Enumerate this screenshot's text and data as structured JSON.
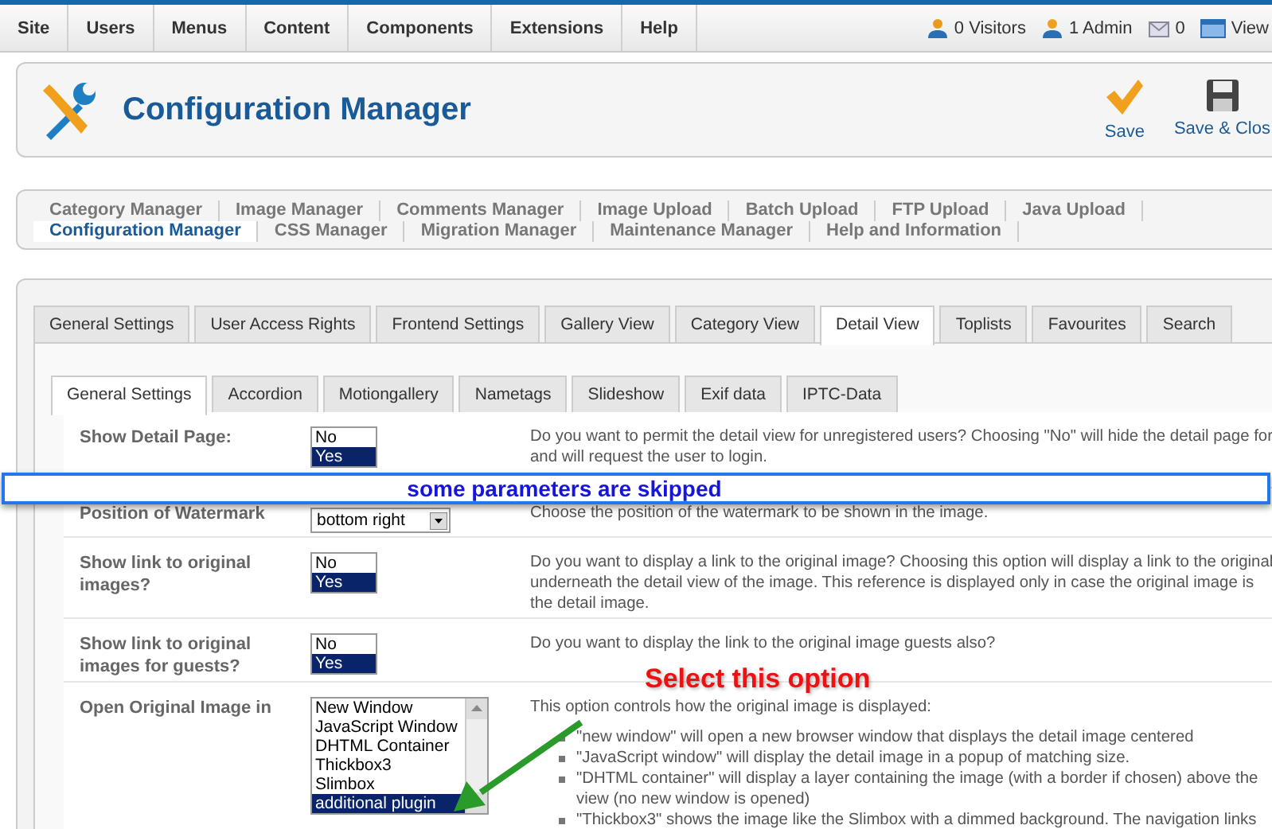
{
  "menu": [
    {
      "label": "Site"
    },
    {
      "label": "Users"
    },
    {
      "label": "Menus"
    },
    {
      "label": "Content"
    },
    {
      "label": "Components"
    },
    {
      "label": "Extensions"
    },
    {
      "label": "Help"
    }
  ],
  "status": [
    {
      "kind": "users",
      "label": "0 Visitors"
    },
    {
      "kind": "admin",
      "label": "1 Admin"
    },
    {
      "kind": "messages",
      "label": "0"
    },
    {
      "kind": "view",
      "label": "View"
    }
  ],
  "title": "Configuration Manager",
  "toolbar": [
    {
      "kind": "check",
      "label": "Save"
    },
    {
      "kind": "disk",
      "label": "Save & Clos"
    }
  ],
  "submenu": [
    [
      {
        "label": "Category Manager",
        "selected": false
      },
      {
        "label": "Image Manager",
        "selected": false
      },
      {
        "label": "Comments Manager",
        "selected": false
      },
      {
        "label": "Image Upload",
        "selected": false
      },
      {
        "label": "Batch Upload",
        "selected": false
      },
      {
        "label": "FTP Upload",
        "selected": false
      },
      {
        "label": "Java Upload",
        "selected": false
      }
    ],
    [
      {
        "label": "Configuration Manager",
        "selected": true
      },
      {
        "label": "CSS Manager",
        "selected": false
      },
      {
        "label": "Migration Manager",
        "selected": false
      },
      {
        "label": "Maintenance Manager",
        "selected": false
      },
      {
        "label": "Help and Information",
        "selected": false
      }
    ]
  ],
  "tabs": [
    {
      "label": "General Settings",
      "selected": false
    },
    {
      "label": "User Access Rights",
      "selected": false
    },
    {
      "label": "Frontend Settings",
      "selected": false
    },
    {
      "label": "Gallery View",
      "selected": false
    },
    {
      "label": "Category View",
      "selected": false
    },
    {
      "label": "Detail View",
      "selected": true
    },
    {
      "label": "Toplists",
      "selected": false
    },
    {
      "label": "Favourites",
      "selected": false
    },
    {
      "label": "Search",
      "selected": false
    }
  ],
  "subtabs": [
    {
      "label": "General Settings",
      "selected": true
    },
    {
      "label": "Accordion",
      "selected": false
    },
    {
      "label": "Motiongallery",
      "selected": false
    },
    {
      "label": "Nametags",
      "selected": false
    },
    {
      "label": "Slideshow",
      "selected": false
    },
    {
      "label": "Exif data",
      "selected": false
    },
    {
      "label": "IPTC-Data",
      "selected": false
    }
  ],
  "rows": [
    {
      "label": "Show Detail Page:",
      "control": {
        "kind": "listbox",
        "options": [
          {
            "label": "No",
            "selected": false
          },
          {
            "label": "Yes",
            "selected": true
          }
        ]
      },
      "lines": [
        "Do you want to permit the detail view for unregistered users? Choosing \"No\" will hide the detail page for",
        "and will request the user to login."
      ]
    },
    {
      "label": "Position of Watermark",
      "control": {
        "kind": "dropdown",
        "value": "bottom right"
      },
      "lines": [
        "Choose the position of the watermark to be shown in the image."
      ]
    },
    {
      "label": "Show link to original images?",
      "control": {
        "kind": "listbox",
        "options": [
          {
            "label": "No",
            "selected": false
          },
          {
            "label": "Yes",
            "selected": true
          }
        ]
      },
      "lines": [
        "Do you want to display a link to the original image? Choosing this option will display a link to the original",
        "underneath the detail view of the image. This reference is displayed only in case the original image is",
        "the detail image."
      ]
    },
    {
      "label": "Show link to original images for guests?",
      "control": {
        "kind": "listbox",
        "options": [
          {
            "label": "No",
            "selected": false
          },
          {
            "label": "Yes",
            "selected": true
          }
        ]
      },
      "lines": [
        "Do you want to display the link to the original image guests also?"
      ]
    },
    {
      "label": "Open Original Image in",
      "control": {
        "kind": "scrolllist",
        "options": [
          {
            "label": "New Window",
            "selected": false
          },
          {
            "label": "JavaScript Window",
            "selected": false
          },
          {
            "label": "DHTML Container",
            "selected": false
          },
          {
            "label": "Thickbox3",
            "selected": false
          },
          {
            "label": "Slimbox",
            "selected": false
          },
          {
            "label": "additional plugin",
            "selected": true
          }
        ]
      },
      "lines": [
        "This option controls how the original image is displayed:"
      ],
      "bullets": [
        [
          "\"new window\" will open a new browser window that displays the detail image centered"
        ],
        [
          "\"JavaScript window\" will display the detail image in a popup of matching size."
        ],
        [
          "\"DHTML container\" will display a layer containing the image (with a border if chosen) above the",
          "view (no new window is opened)"
        ],
        [
          "\"Thickbox3\" shows the image like the Slimbox with a dimmed background. The navigation links"
        ]
      ]
    }
  ],
  "banner": "some parameters are skipped",
  "callout": "Select this option"
}
